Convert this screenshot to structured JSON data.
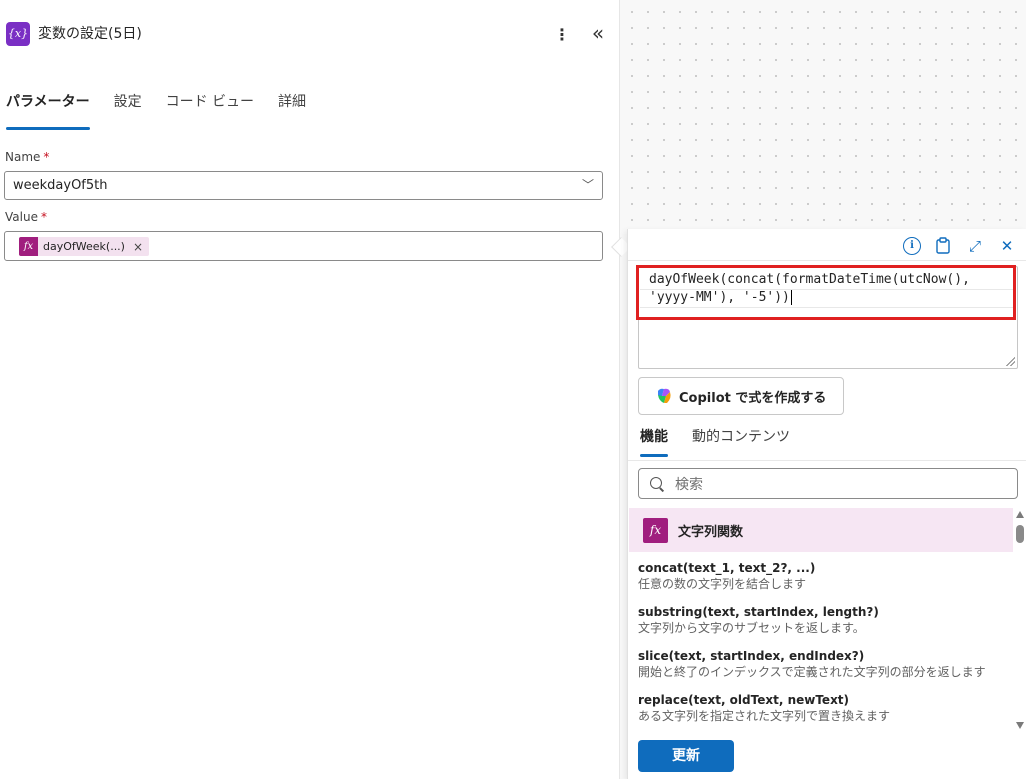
{
  "header": {
    "icon_glyph": "{x}",
    "title": "変数の設定(5日)"
  },
  "tabs": [
    {
      "label": "パラメーター",
      "active": true
    },
    {
      "label": "設定",
      "active": false
    },
    {
      "label": "コード ビュー",
      "active": false
    },
    {
      "label": "詳細",
      "active": false
    }
  ],
  "fields": {
    "name": {
      "label": "Name",
      "required_mark": "*",
      "value": "weekdayOf5th"
    },
    "value": {
      "label": "Value",
      "required_mark": "*",
      "token_icon": "fx",
      "token_label": "dayOfWeek(...)",
      "token_remove": "×"
    }
  },
  "expression_editor": {
    "line1": "dayOfWeek(concat(formatDateTime(utcNow(),",
    "line2": "'yyyy-MM'), '-5'))",
    "highlight_color": "#e02020"
  },
  "copilot": {
    "label": "Copilot で式を作成する"
  },
  "function_tabs": [
    {
      "label": "機能",
      "active": true
    },
    {
      "label": "動的コンテンツ",
      "active": false
    }
  ],
  "search": {
    "placeholder": "検索"
  },
  "category": {
    "icon": "fx",
    "label": "文字列関数"
  },
  "functions": [
    {
      "signature": "concat(text_1, text_2?, ...)",
      "description": "任意の数の文字列を結合します"
    },
    {
      "signature": "substring(text, startIndex, length?)",
      "description": "文字列から文字のサブセットを返します。"
    },
    {
      "signature": "slice(text, startIndex, endIndex?)",
      "description": "開始と終了のインデックスで定義された文字列の部分を返します"
    },
    {
      "signature": "replace(text, oldText, newText)",
      "description": "ある文字列を指定された文字列で置き換えます"
    }
  ],
  "update_button": {
    "label": "更新"
  },
  "colors": {
    "accent": "#0f6cbd",
    "variable_icon": "#7a2fc4",
    "expression_token": "#a01e7e",
    "token_bg": "#f3e1ef"
  },
  "icons": [
    "variable-icon",
    "more-options-icon",
    "collapse-icon",
    "chevron-down-icon",
    "info-icon",
    "clipboard-icon",
    "expand-icon",
    "close-icon",
    "copilot-icon",
    "search-icon",
    "function-icon"
  ]
}
